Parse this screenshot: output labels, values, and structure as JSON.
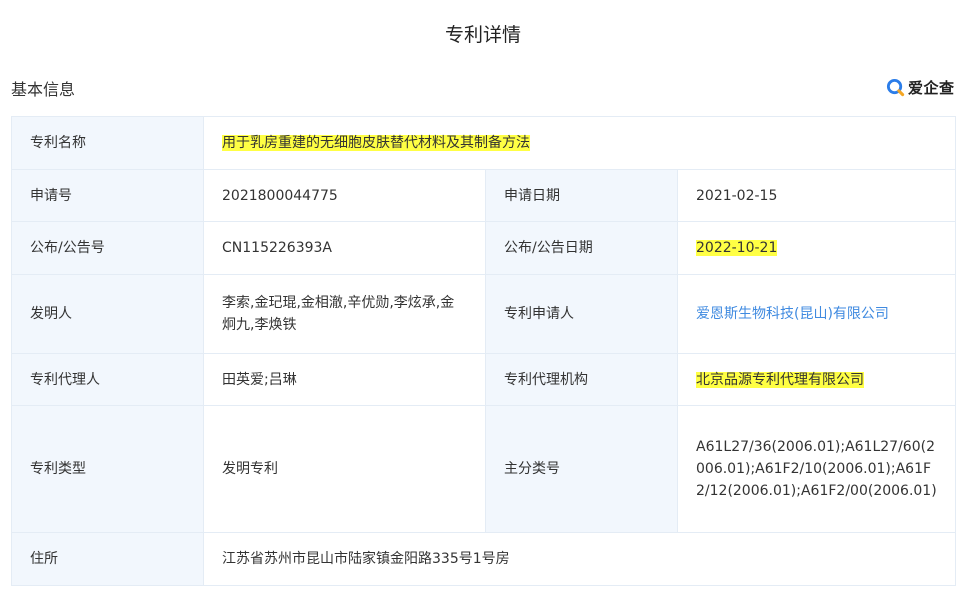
{
  "page": {
    "title": "专利详情"
  },
  "section": {
    "title": "基本信息"
  },
  "brand": {
    "name": "爱企查",
    "icon": "search-magnifier-logo",
    "accent": "#2b7de9",
    "accent2": "#f5a623"
  },
  "colors": {
    "label_bg": "#f2f7fd",
    "border": "#e4ecf5",
    "highlight": "#ffff44",
    "link": "#3f8ae0"
  },
  "fields": {
    "patent_name": {
      "label": "专利名称",
      "value": "用于乳房重建的无细胞皮肤替代材料及其制备方法"
    },
    "application_no": {
      "label": "申请号",
      "value": "2021800044775"
    },
    "application_date": {
      "label": "申请日期",
      "value": "2021-02-15"
    },
    "publication_no": {
      "label": "公布/公告号",
      "value": "CN115226393A"
    },
    "publication_date": {
      "label": "公布/公告日期",
      "value": "2022-10-21"
    },
    "inventors": {
      "label": "发明人",
      "value": "李索,金玘琨,金相澈,辛优勋,李炫承,金炯九,李焕铁"
    },
    "applicant": {
      "label": "专利申请人",
      "value": "爱恩斯生物科技(昆山)有限公司"
    },
    "agent": {
      "label": "专利代理人",
      "value": "田英爱;吕琳"
    },
    "agency": {
      "label": "专利代理机构",
      "value": "北京品源专利代理有限公司"
    },
    "patent_type": {
      "label": "专利类型",
      "value": "发明专利"
    },
    "main_class": {
      "label": "主分类号",
      "value": "A61L27/36(2006.01);A61L27/60(2006.01);A61F2/10(2006.01);A61F2/12(2006.01);A61F2/00(2006.01)"
    },
    "address": {
      "label": "住所",
      "value": "江苏省苏州市昆山市陆家镇金阳路335号1号房"
    }
  }
}
